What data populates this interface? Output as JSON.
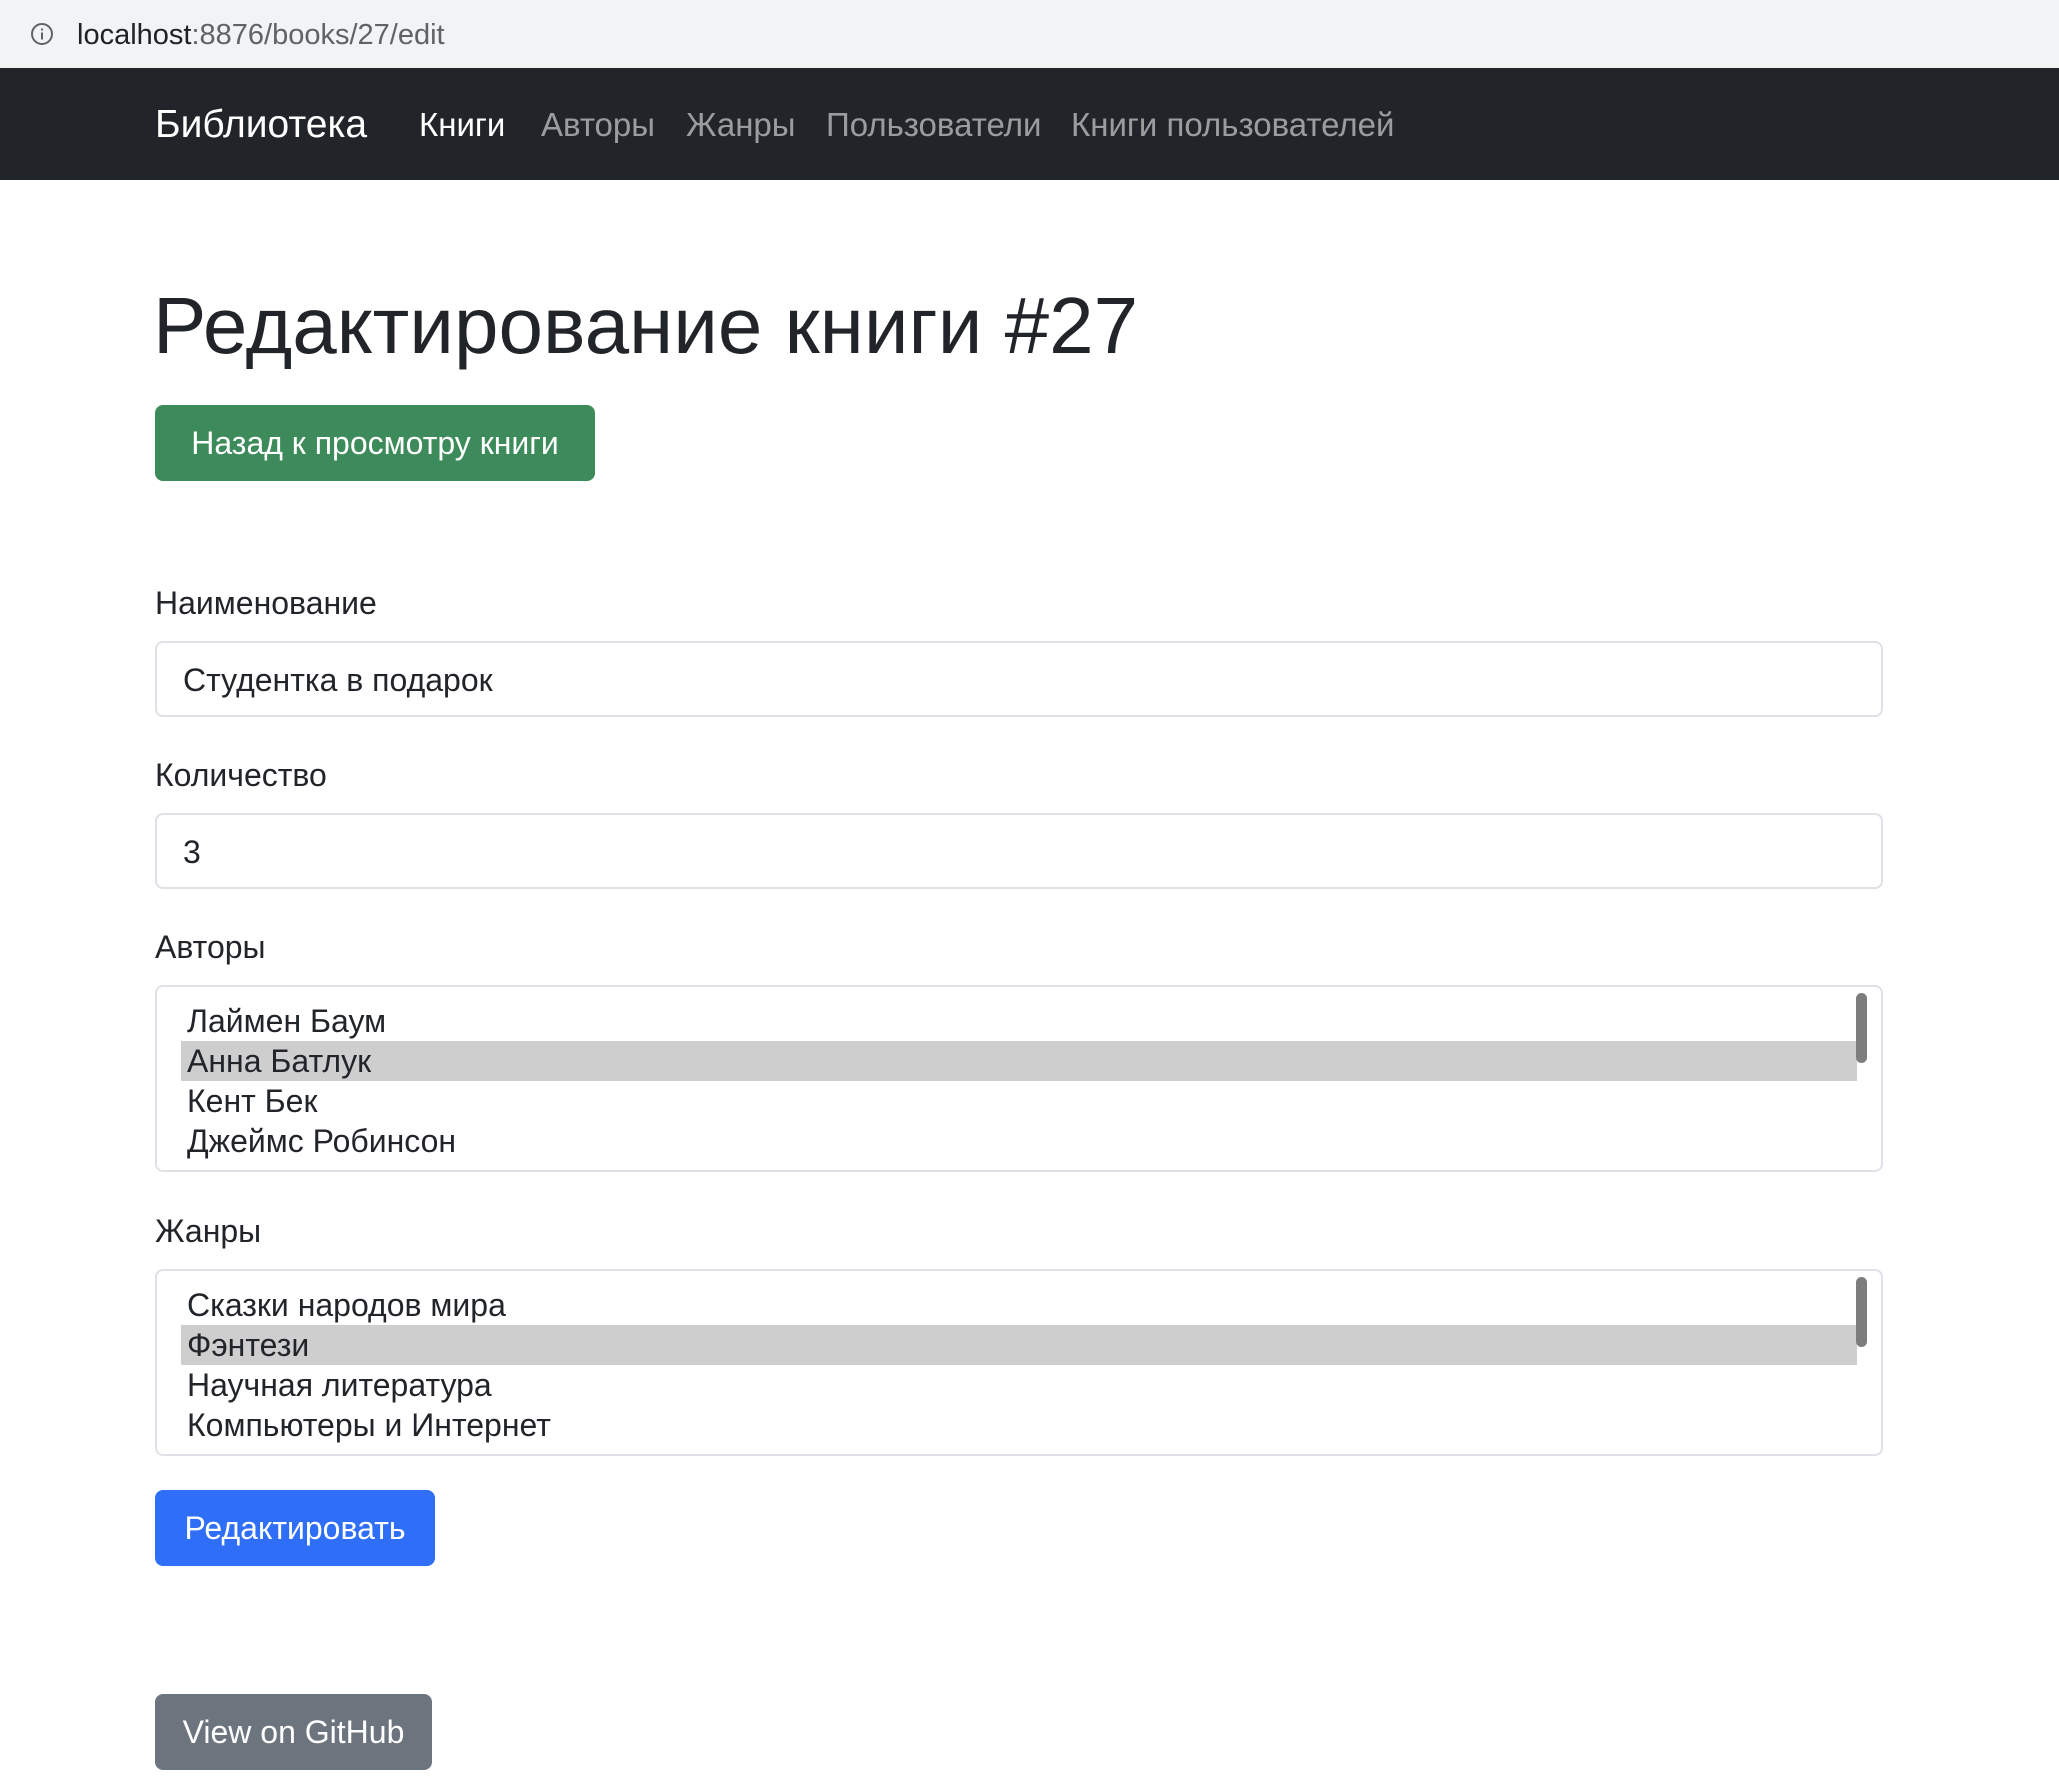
{
  "browser": {
    "url_host": "localhost",
    "url_rest": ":8876/books/27/edit"
  },
  "navbar": {
    "brand": "Библиотека",
    "items": [
      {
        "label": "Книги",
        "active": true
      },
      {
        "label": "Авторы",
        "active": false
      },
      {
        "label": "Жанры",
        "active": false
      },
      {
        "label": "Пользователи",
        "active": false
      },
      {
        "label": "Книги пользователей",
        "active": false
      }
    ]
  },
  "page": {
    "title": "Редактирование книги #27",
    "back_button": "Назад к просмотру книги"
  },
  "form": {
    "name_label": "Наименование",
    "name_value": "Студентка в подарок",
    "quantity_label": "Количество",
    "quantity_value": "3",
    "authors_label": "Авторы",
    "authors": [
      {
        "label": "Лаймен Баум",
        "selected": false
      },
      {
        "label": "Анна Батлук",
        "selected": true
      },
      {
        "label": "Кент Бек",
        "selected": false
      },
      {
        "label": "Джеймс Робинсон",
        "selected": false
      }
    ],
    "genres_label": "Жанры",
    "genres": [
      {
        "label": "Сказки народов мира",
        "selected": false
      },
      {
        "label": "Фэнтези",
        "selected": true
      },
      {
        "label": "Научная литература",
        "selected": false
      },
      {
        "label": "Компьютеры и Интернет",
        "selected": false
      }
    ],
    "submit_button": "Редактировать"
  },
  "footer": {
    "github_button": "View on GitHub"
  },
  "colors": {
    "navbar_bg": "#212529",
    "back_button": "#3d8a5b",
    "submit_button": "#2f6ef6",
    "github_button": "#6c757d",
    "selected_option": "#cecece"
  }
}
